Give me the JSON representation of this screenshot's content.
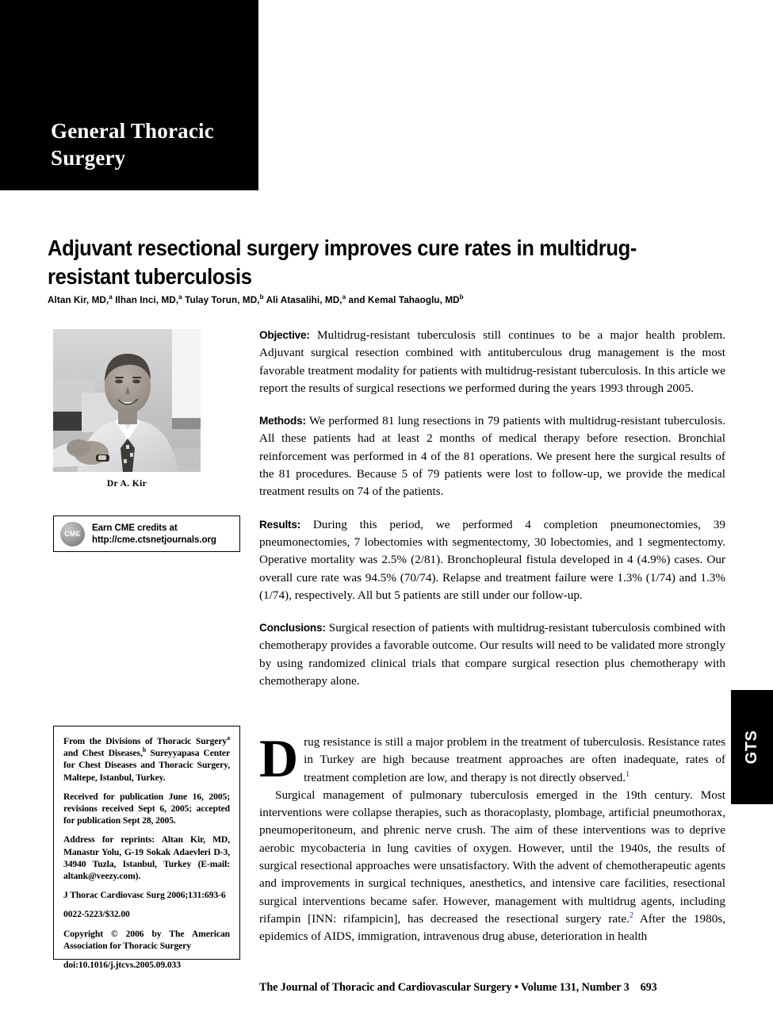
{
  "masthead": {
    "section_title_line1": "General Thoracic",
    "section_title_line2": "Surgery"
  },
  "article": {
    "title": "Adjuvant resectional surgery improves cure rates in multidrug-resistant tuberculosis",
    "authors_segments": [
      {
        "text": "Altan Kir, MD,",
        "sup": "a"
      },
      {
        "text": " Ilhan Inci, MD,",
        "sup": "a"
      },
      {
        "text": " Tulay Torun, MD,",
        "sup": "b"
      },
      {
        "text": " Ali Atasalihi, MD,",
        "sup": "a"
      },
      {
        "text": " and Kemal Tahaoglu, MD",
        "sup": "b"
      }
    ],
    "authors_plain": "Altan Kir, MD,a Ilhan Inci, MD,a Tulay Torun, MD,b Ali Atasalihi, MD,a and Kemal Tahaoglu, MDb"
  },
  "photo": {
    "alt": "Portrait photograph of Dr A. Kir, smiling man in white shirt and dark patterned tie seated with hands clasped",
    "caption": "Dr A. Kir"
  },
  "cme": {
    "logo_text": "CME",
    "line1": "Earn CME credits at",
    "line2": "http://cme.ctsnetjournals.org"
  },
  "abstract": {
    "objective_label": "Objective:",
    "objective_text": " Multidrug-resistant tuberculosis still continues to be a major health problem. Adjuvant surgical resection combined with antituberculous drug management is the most favorable treatment modality for patients with multidrug-resistant tuberculosis. In this article we report the results of surgical resections we performed during the years 1993 through 2005.",
    "methods_label": "Methods:",
    "methods_text": " We performed 81 lung resections in 79 patients with multidrug-resistant tuberculosis. All these patients had at least 2 months of medical therapy before resection. Bronchial reinforcement was performed in 4 of the 81 operations. We present here the surgical results of the 81 procedures. Because 5 of 79 patients were lost to follow-up, we provide the medical treatment results on 74 of the patients.",
    "results_label": "Results:",
    "results_text": " During this period, we performed 4 completion pneumonectomies, 39 pneumonectomies, 7 lobectomies with segmentectomy, 30 lobectomies, and 1 segmentectomy. Operative mortality was 2.5% (2/81). Bronchopleural fistula developed in 4 (4.9%) cases. Our overall cure rate was 94.5% (70/74). Relapse and treatment failure were 1.3% (1/74) and 1.3% (1/74), respectively. All but 5 patients are still under our follow-up.",
    "conclusions_label": "Conclusions:",
    "conclusions_text": " Surgical resection of patients with multidrug-resistant tuberculosis combined with chemotherapy provides a favorable outcome. Our results will need to be validated more strongly by using randomized clinical trials that compare surgical resection plus chemotherapy with chemotherapy alone."
  },
  "footnotes": {
    "affiliation_pre": "From the Divisions of Thoracic Surgery",
    "affiliation_sup_a": "a",
    "affiliation_mid": " and Chest Diseases,",
    "affiliation_sup_b": "b",
    "affiliation_post": " Sureyyapasa Center for Chest Diseases and Thoracic Surgery, Maltepe, Istanbul, Turkey.",
    "received": "Received for publication June 16, 2005; revisions received Sept 6, 2005; accepted for publication Sept 28, 2005.",
    "reprints": "Address for reprints: Altan Kir, MD, Manastır Yolu, G-19 Sokak Adaevleri D-3, 34940 Tuzla, Istanbul, Turkey (E-mail: altank@veezy.com).",
    "citation": "J Thorac Cardiovasc Surg 2006;131:693-6",
    "issn": "0022-5223/$32.00",
    "copyright": "Copyright © 2006 by The American Association for Thoracic Surgery",
    "doi": "doi:10.1016/j.jtcvs.2005.09.033"
  },
  "body": {
    "dropcap": "D",
    "para1_rest": "rug resistance is still a major problem in the treatment of tuberculosis. Resistance rates in Turkey are high because treatment approaches are often inadequate, rates of treatment completion are low, and therapy is not directly observed.",
    "para1_ref": "1",
    "para2_a": "Surgical management of pulmonary tuberculosis emerged in the 19th century. Most interventions were collapse therapies, such as thoracoplasty, plombage, artificial pneumothorax, pneumoperitoneum, and phrenic nerve crush. The aim of these interventions was to deprive aerobic mycobacteria in lung cavities of oxygen. However, until the 1940s, the results of surgical resectional approaches were unsatisfactory. With the advent of chemotherapeutic agents and improvements in surgical techniques, anesthetics, and intensive care facilities, resectional surgical interventions became safer. However, management with multidrug agents, including rifampin [INN: rifampicin], has decreased the resectional surgery rate.",
    "para2_ref": "2",
    "para2_b": " After the 1980s, epidemics of AIDS, immigration, intravenous drug abuse, deterioration in health"
  },
  "side_tab": {
    "label": "GTS"
  },
  "footer": {
    "journal_line": "The Journal of Thoracic and Cardiovascular Surgery • Volume 131, Number 3",
    "page_number": "693"
  },
  "colors": {
    "banner_background": "#000000",
    "banner_text": "#ffffff",
    "page_background": "#ffffff",
    "body_text": "#000000",
    "reference_mark": "#1a1a8c"
  }
}
